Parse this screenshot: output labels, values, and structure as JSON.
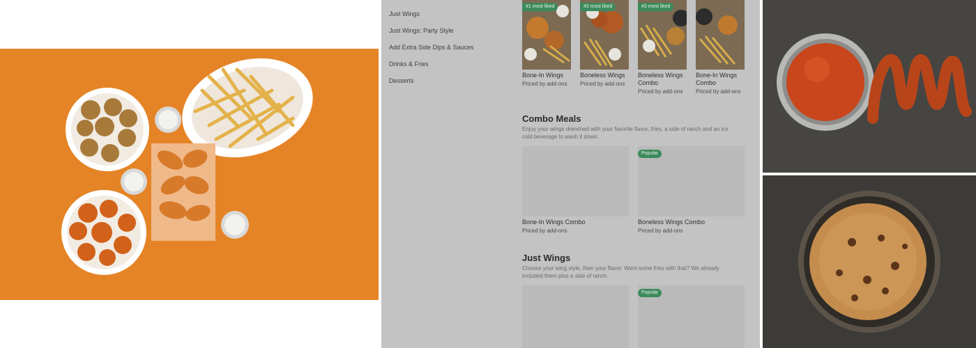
{
  "menu_nav": {
    "items": [
      {
        "label": "Just Wings"
      },
      {
        "label": "Just Wings: Party Style"
      },
      {
        "label": "Add Extra Side Dips & Sauces"
      },
      {
        "label": "Drinks & Fries"
      },
      {
        "label": "Desserts"
      }
    ]
  },
  "top_items": [
    {
      "badge": "#1 most liked",
      "name": "Bone-In Wings",
      "price": "Priced by add-ons"
    },
    {
      "badge": "#2 most liked",
      "name": "Boneless Wings",
      "price": "Priced by add-ons"
    },
    {
      "badge": "#3 most liked",
      "name": "Boneless Wings Combo",
      "price": "Priced by add-ons"
    },
    {
      "badge": "",
      "name": "Bone-In Wings Combo",
      "price": "Priced by add-ons"
    }
  ],
  "combo_meals": {
    "title": "Combo Meals",
    "description": "Enjoy your wings drenched with your favorite flavor, fries, a side of ranch and an ice cold beverage to wash it down.",
    "items": [
      {
        "badge": "",
        "name": "Bone-In Wings Combo",
        "price": "Priced by add-ons"
      },
      {
        "badge": "Popular",
        "name": "Boneless Wings Combo",
        "price": "Priced by add-ons"
      }
    ]
  },
  "just_wings": {
    "title": "Just Wings",
    "description": "Choose your wing style, then your flavor. Want some fries with that? We already included them plus a side of ranch.",
    "items": [
      {
        "badge": ""
      },
      {
        "badge": "Popular"
      }
    ]
  },
  "colors": {
    "hero_background": "#ea8a2a",
    "overlay": "#c3c3c3",
    "badge_green": "#3d8a5c"
  }
}
